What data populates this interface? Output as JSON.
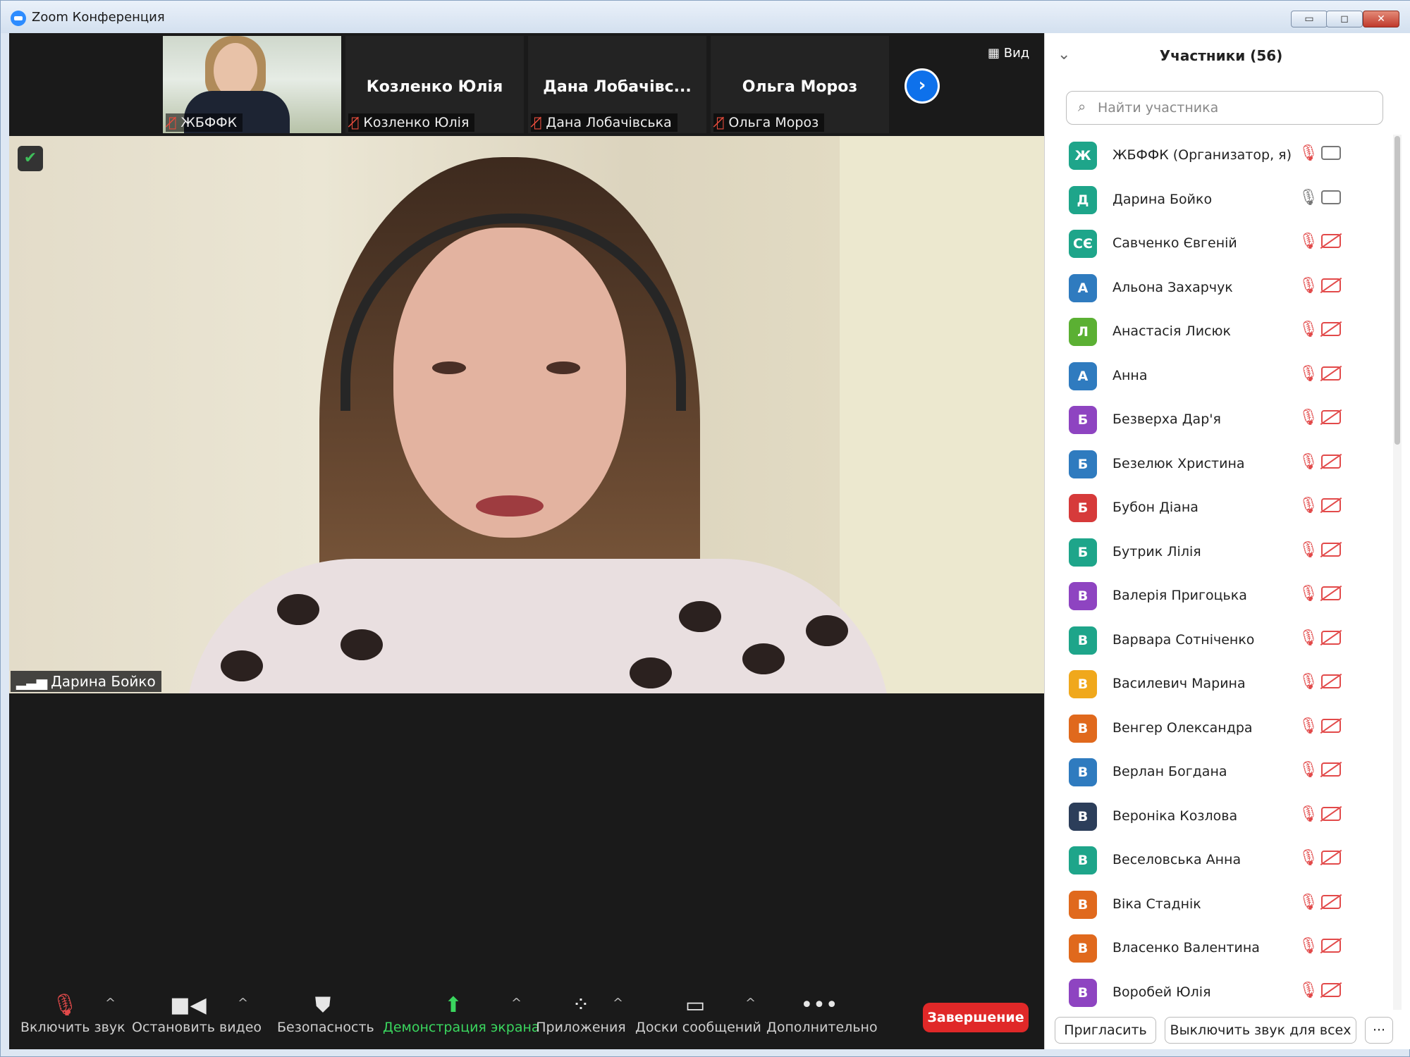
{
  "window": {
    "title": "Zoom Конференция",
    "minimize": "▭",
    "maximize": "◻",
    "close": "✕"
  },
  "filmstrip": {
    "tiles": [
      {
        "label": "ЖБФФК",
        "display_name": ""
      },
      {
        "label": "Козленко Юлія",
        "display_name": "Козленко Юлія"
      },
      {
        "label": "Дана Лобачівська",
        "display_name": "Дана Лобачівс..."
      },
      {
        "label": "Ольга Мороз",
        "display_name": "Ольга Мороз"
      }
    ],
    "next_icon": "›",
    "view_label": "Вид"
  },
  "main_video": {
    "speaker": "Дарина Бойко",
    "signal_icon": "signal-bars-icon",
    "security_icon": "shield-check-icon"
  },
  "toolbar": {
    "unmute": "Включить звук",
    "stop_video": "Остановить видео",
    "security": "Безопасность",
    "share": "Демонстрация экрана",
    "apps": "Приложения",
    "whiteboards": "Доски сообщений",
    "more": "Дополнительно",
    "end": "Завершение",
    "caret": "^"
  },
  "participants": {
    "title": "Участники (56)",
    "search_placeholder": "Найти участника",
    "list": [
      {
        "initial": "Ж",
        "name": "ЖБФФК (Организатор, я)",
        "color": "#1ea58a",
        "mic": "muted",
        "cam": "on"
      },
      {
        "initial": "Д",
        "name": "Дарина Бойко",
        "color": "#1ea58a",
        "mic": "on",
        "cam": "on"
      },
      {
        "initial": "СЄ",
        "name": "Савченко Євгеній",
        "color": "#1ea58a",
        "mic": "muted",
        "cam": "off"
      },
      {
        "initial": "А",
        "name": "Альона Захарчук",
        "color": "#2f7bbf",
        "mic": "muted",
        "cam": "off"
      },
      {
        "initial": "Л",
        "name": "Анастасія Лисюк",
        "color": "#5bb033",
        "mic": "muted",
        "cam": "off"
      },
      {
        "initial": "А",
        "name": "Анна",
        "color": "#2f7bbf",
        "mic": "muted",
        "cam": "off"
      },
      {
        "initial": "Б",
        "name": "Безверха Дар'я",
        "color": "#8e44c1",
        "mic": "muted",
        "cam": "off"
      },
      {
        "initial": "Б",
        "name": "Безелюк Христина",
        "color": "#2f7bbf",
        "mic": "muted",
        "cam": "off"
      },
      {
        "initial": "Б",
        "name": "Бубон Діана",
        "color": "#d63a3a",
        "mic": "muted",
        "cam": "off"
      },
      {
        "initial": "Б",
        "name": "Бутрик Лілія",
        "color": "#1ea58a",
        "mic": "muted",
        "cam": "off"
      },
      {
        "initial": "В",
        "name": "Валерія Пригоцька",
        "color": "#8e44c1",
        "mic": "muted",
        "cam": "off"
      },
      {
        "initial": "В",
        "name": "Варвара Сотніченко",
        "color": "#1ea58a",
        "mic": "muted",
        "cam": "off"
      },
      {
        "initial": "В",
        "name": "Василевич Марина",
        "color": "#f0a81c",
        "mic": "muted",
        "cam": "off"
      },
      {
        "initial": "В",
        "name": "Венгер Олександра",
        "color": "#e0691d",
        "mic": "muted",
        "cam": "off"
      },
      {
        "initial": "В",
        "name": "Верлан Богдана",
        "color": "#2f7bbf",
        "mic": "muted",
        "cam": "off"
      },
      {
        "initial": "В",
        "name": "Вероніка Козлова",
        "color": "#2c3e5a",
        "mic": "muted",
        "cam": "off"
      },
      {
        "initial": "В",
        "name": "Веселовська Анна",
        "color": "#1ea58a",
        "mic": "muted",
        "cam": "off"
      },
      {
        "initial": "В",
        "name": "Віка Стаднік",
        "color": "#e0691d",
        "mic": "muted",
        "cam": "off"
      },
      {
        "initial": "В",
        "name": "Власенко Валентина",
        "color": "#e0691d",
        "mic": "muted",
        "cam": "off"
      },
      {
        "initial": "В",
        "name": "Воробей Юлія",
        "color": "#8e44c1",
        "mic": "muted",
        "cam": "off"
      }
    ],
    "invite": "Пригласить",
    "mute_all": "Выключить звук для всех",
    "more": "···"
  },
  "colors": {
    "accent": "#0e71eb",
    "end": "#e02828",
    "share": "#3ad65e"
  }
}
